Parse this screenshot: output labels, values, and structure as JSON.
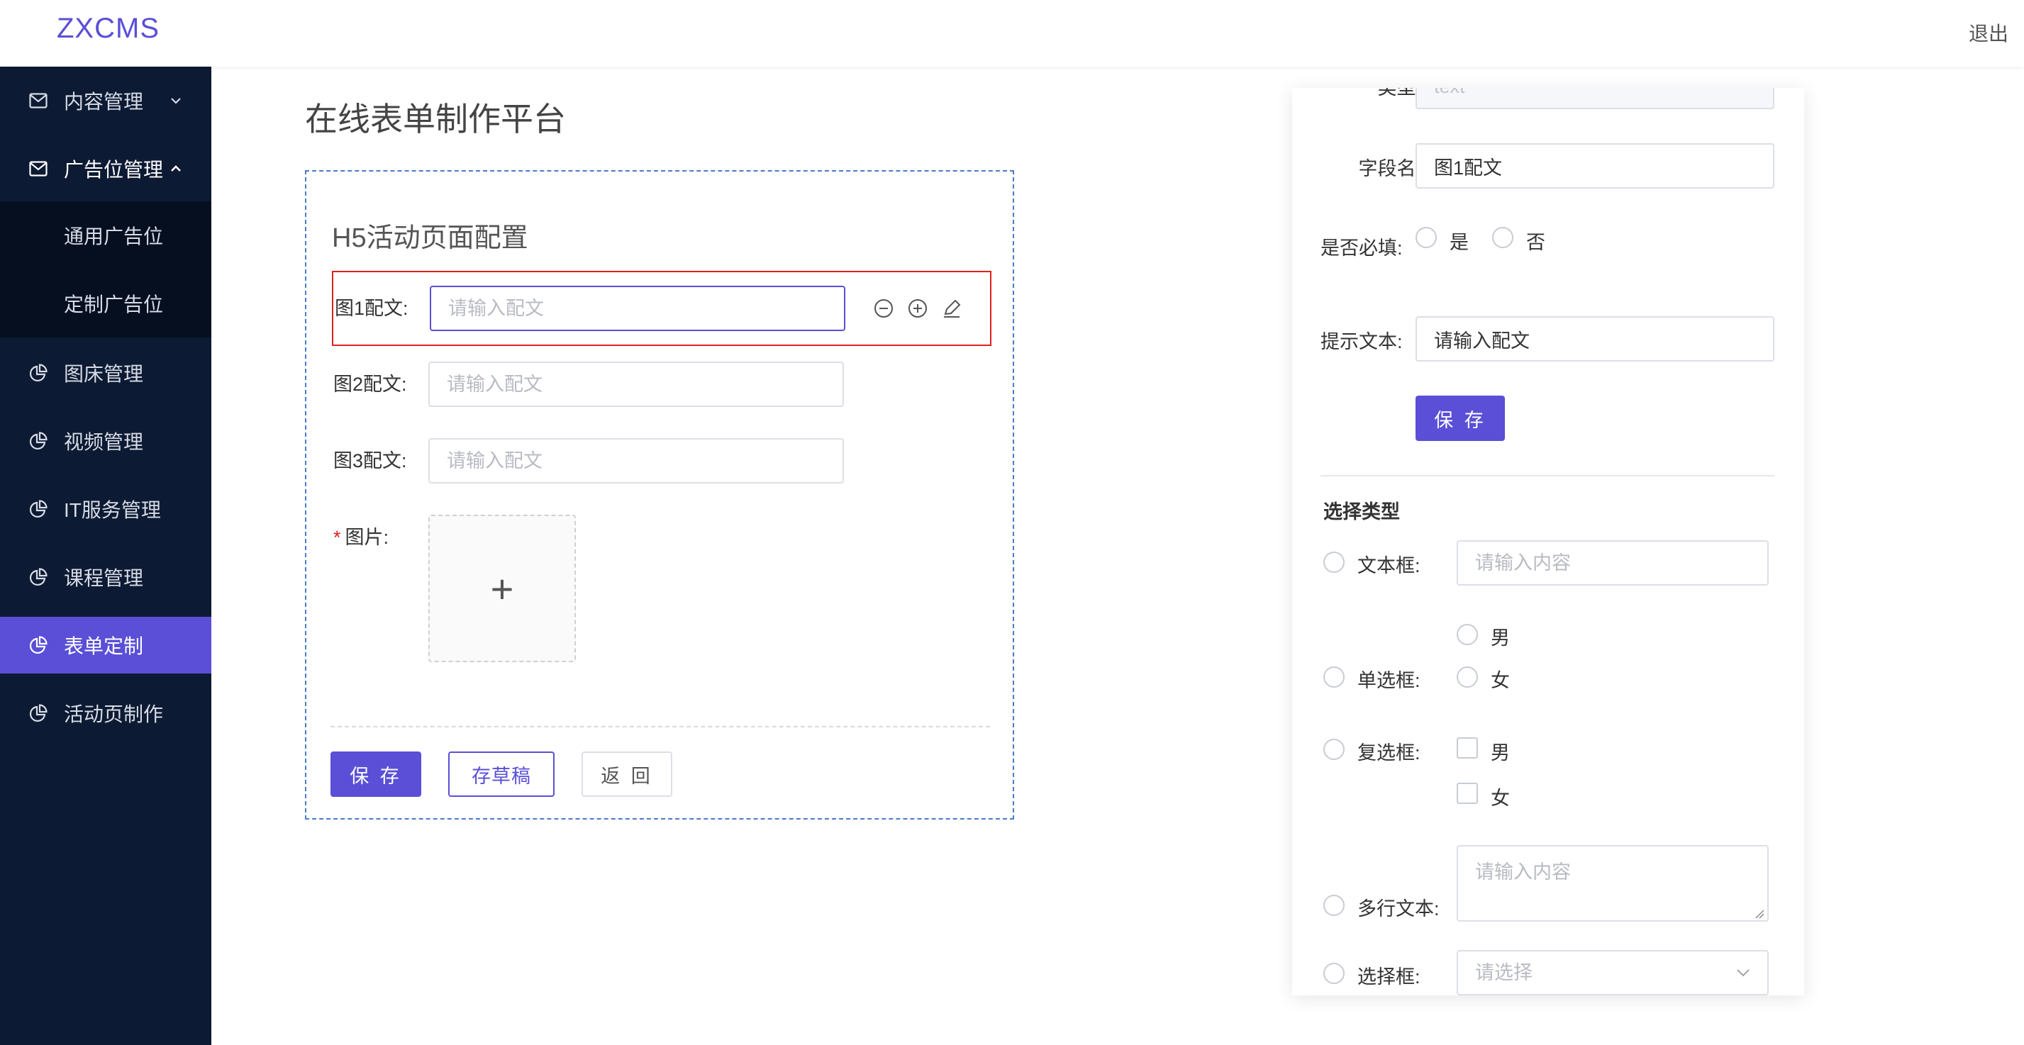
{
  "header": {
    "logo": "ZXCMS",
    "logout": "退出"
  },
  "sidebar": {
    "items": [
      {
        "label": "内容管理",
        "icon": "mail-icon"
      },
      {
        "label": "广告位管理",
        "icon": "mail-icon"
      },
      {
        "label": "图床管理",
        "icon": "pie-chart-icon"
      },
      {
        "label": "视频管理",
        "icon": "pie-chart-icon"
      },
      {
        "label": "IT服务管理",
        "icon": "pie-chart-icon"
      },
      {
        "label": "课程管理",
        "icon": "pie-chart-icon"
      },
      {
        "label": "表单定制",
        "icon": "pie-chart-icon"
      },
      {
        "label": "活动页制作",
        "icon": "pie-chart-icon"
      }
    ],
    "sub_items": [
      {
        "label": "通用广告位"
      },
      {
        "label": "定制广告位"
      }
    ],
    "active": "表单定制",
    "accent_color": "#5a4fd6"
  },
  "main": {
    "title": "在线表单制作平台",
    "form": {
      "title": "H5活动页面配置",
      "fields": [
        {
          "label": "图1配文:",
          "placeholder": "请输入配文",
          "selected": true
        },
        {
          "label": "图2配文:",
          "placeholder": "请输入配文"
        },
        {
          "label": "图3配文:",
          "placeholder": "请输入配文"
        }
      ],
      "image_field": {
        "required_mark": "*",
        "label": "图片:",
        "upload_symbol": "+"
      },
      "buttons": {
        "save": "保 存",
        "draft": "存草稿",
        "back": "返 回"
      }
    }
  },
  "panel": {
    "type_label": "类型:",
    "type_value": "text",
    "field_name_label": "字段名:",
    "field_name_value": "图1配文",
    "required_label": "是否必填:",
    "required_yes": "是",
    "required_no": "否",
    "hint_label": "提示文本:",
    "hint_value": "请输入配文",
    "save_button": "保 存",
    "select_type_title": "选择类型",
    "types": {
      "text_label": "文本框:",
      "text_placeholder": "请输入内容",
      "radio_label": "单选框:",
      "radio_options": [
        "男",
        "女"
      ],
      "checkbox_label": "复选框:",
      "checkbox_options": [
        "男",
        "女"
      ],
      "textarea_label": "多行文本:",
      "textarea_placeholder": "请输入内容",
      "select_label": "选择框:",
      "select_placeholder": "请选择"
    }
  }
}
